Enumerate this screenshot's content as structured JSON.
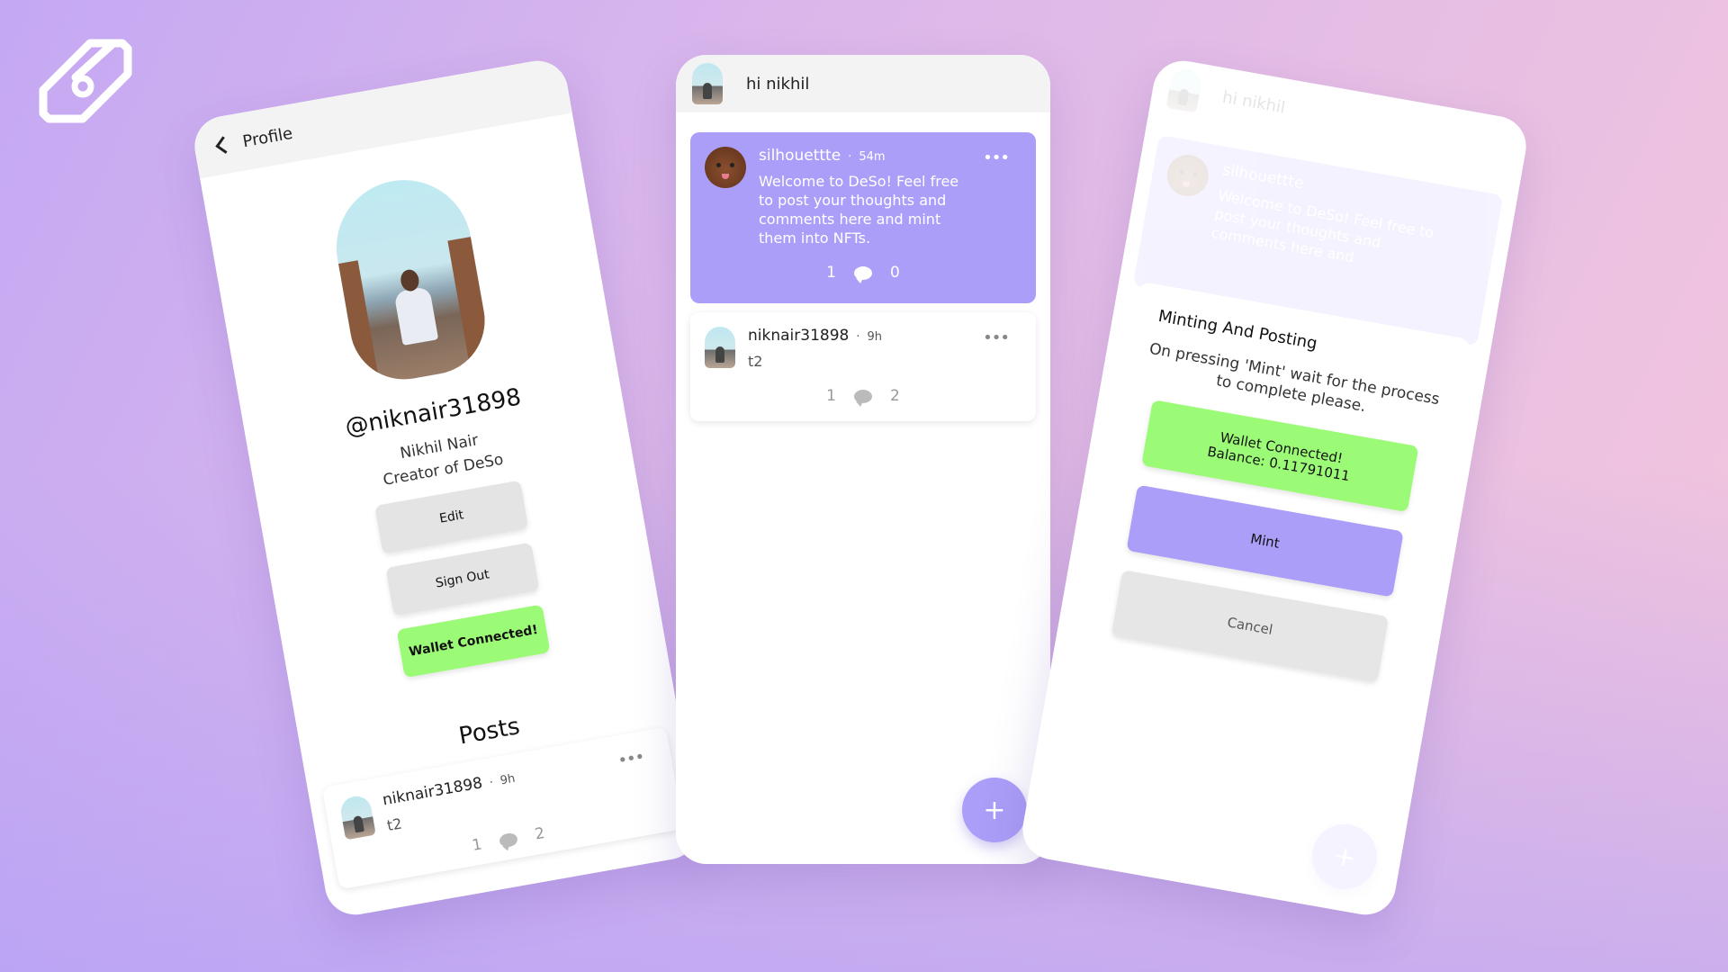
{
  "left_phone": {
    "header_title": "Profile",
    "handle": "@niknair31898",
    "name": "Nikhil Nair",
    "bio": "Creator of DeSo",
    "edit_label": "Edit",
    "signout_label": "Sign Out",
    "wallet_label": "Wallet Connected!",
    "posts_title": "Posts",
    "post": {
      "username": "niknair31898",
      "time": "9h",
      "text": "t2",
      "likes": "1",
      "comments": "2"
    }
  },
  "mid_phone": {
    "greeting": "hi nikhil",
    "posts": [
      {
        "username": "silhouettte",
        "time": "54m",
        "text": "Welcome to DeSo! Feel free to post your thoughts and comments here and mint them into NFTs.",
        "likes": "1",
        "comments": "0"
      },
      {
        "username": "niknair31898",
        "time": "9h",
        "text": "t2",
        "likes": "1",
        "comments": "2"
      }
    ],
    "fab_label": "+"
  },
  "right_phone": {
    "greeting": "hi nikhil",
    "bg_post": {
      "username": "silhouettte",
      "text": "Welcome to DeSo! Feel free to post your thoughts and comments here and"
    },
    "modal_title": "Minting And Posting",
    "modal_text": "On pressing 'Mint' wait for the process to complete please.",
    "wallet_line1": "Wallet Connected!",
    "wallet_line2": "Balance: 0.11791011",
    "mint_label": "Mint",
    "cancel_label": "Cancel",
    "fab_label": "+"
  },
  "colors": {
    "accent": "#aa9ef8",
    "green": "#9cfb76"
  }
}
